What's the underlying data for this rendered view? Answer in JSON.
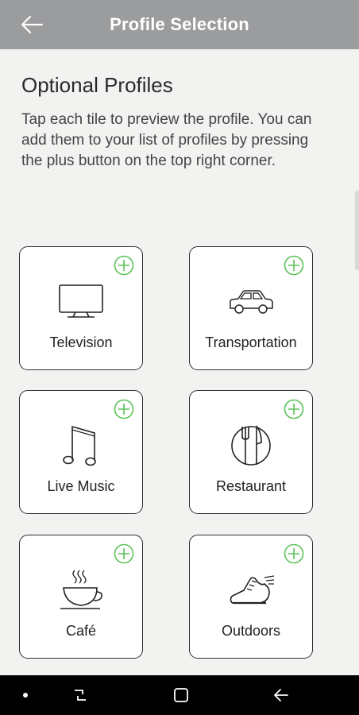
{
  "header": {
    "title": "Profile Selection",
    "back_icon": "arrow-left-icon"
  },
  "content": {
    "heading": "Optional Profiles",
    "description": "Tap each tile to preview the profile. You can add them to your list of profiles by pressing the plus button on the top right corner."
  },
  "tiles": [
    {
      "label": "Television",
      "icon": "television-icon"
    },
    {
      "label": "Transportation",
      "icon": "car-icon"
    },
    {
      "label": "Live Music",
      "icon": "music-note-icon"
    },
    {
      "label": "Restaurant",
      "icon": "plate-cutlery-icon"
    },
    {
      "label": "Café",
      "icon": "coffee-cup-icon"
    },
    {
      "label": "Outdoors",
      "icon": "sneaker-icon"
    }
  ],
  "colors": {
    "accent": "#5cc25a",
    "app_bar": "#9b9c9e",
    "background": "#f2f2f0"
  },
  "system_nav": {
    "icons": [
      "dot-icon",
      "recent-apps-icon",
      "home-icon",
      "back-icon"
    ]
  }
}
